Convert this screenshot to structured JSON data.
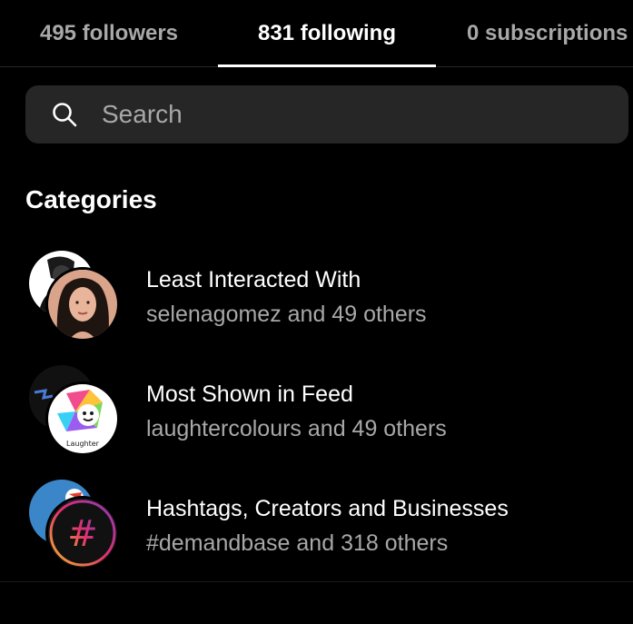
{
  "tabs": {
    "followers": "495 followers",
    "following": "831 following",
    "subscriptions": "0 subscriptions"
  },
  "search": {
    "placeholder": "Search"
  },
  "categories": {
    "title": "Categories",
    "items": [
      {
        "title": "Least Interacted With",
        "subtitle": "selenagomez and 49 others"
      },
      {
        "title": "Most Shown in Feed",
        "subtitle": "laughtercolours and 49 others"
      },
      {
        "title": "Hashtags, Creators and Businesses",
        "subtitle": "#demandbase and 318 others"
      }
    ]
  },
  "avatars": {
    "laughter_logo_text": "Laughter",
    "hashtag_symbol": "#"
  },
  "colors": {
    "background": "#000000",
    "text_primary": "#ffffff",
    "text_secondary": "#a8a8a8",
    "search_bg": "#262626"
  }
}
